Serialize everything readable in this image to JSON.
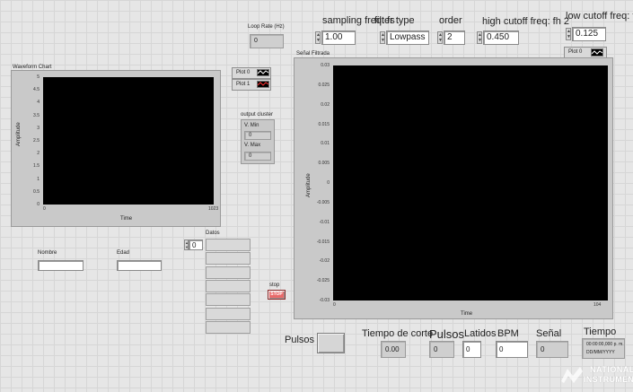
{
  "loop_rate": {
    "label": "Loop Rate (Hz)",
    "value": "0"
  },
  "controls": {
    "sampling": {
      "label": "sampling freq: fs",
      "value": "1.00"
    },
    "filter_type": {
      "label": "filter type",
      "value": "Lowpass"
    },
    "order": {
      "label": "order",
      "value": "2"
    },
    "high_cutoff": {
      "label": "high cutoff freq: fh",
      "value": "0.450",
      "suffix": "2"
    },
    "low_cutoff": {
      "label": "low cutoff freq: fl",
      "value": "0.125"
    }
  },
  "waveform_chart": {
    "label": "Waveform Chart",
    "y_title": "Amplitude",
    "x_title": "Time",
    "y_ticks": [
      "5",
      "4.5",
      "4",
      "3.5",
      "3",
      "2.5",
      "2",
      "1.5",
      "1",
      "0.5",
      "0"
    ],
    "x_start": "0",
    "x_end": "1023"
  },
  "plot_legend": [
    {
      "label": "Plot 0",
      "icon": "waveform-white-icon"
    },
    {
      "label": "Plot 1",
      "icon": "waveform-red-icon"
    }
  ],
  "output_cluster": {
    "label": "output cluster",
    "vmin_label": "V. Min",
    "vmin_value": "0",
    "vmax_label": "V. Max",
    "vmax_value": "0"
  },
  "senal_filtrada": {
    "label": "Señal Filtrada",
    "y_title": "Amplitude",
    "x_title": "Time",
    "y_ticks": [
      "0.03",
      "0.025",
      "0.02",
      "0.015",
      "0.01",
      "0.005",
      "0",
      "-0.005",
      "-0.01",
      "-0.015",
      "-0.02",
      "-0.025",
      "-0.03"
    ],
    "x_start": "0",
    "x_end": "104",
    "legend": "Plot 0"
  },
  "nombre": {
    "label": "Nombre",
    "value": ""
  },
  "edad": {
    "label": "Edad",
    "value": ""
  },
  "datos": {
    "label": "Datos",
    "index": "0"
  },
  "stop": {
    "label": "stop",
    "button": "STOP"
  },
  "pulsos_button": {
    "label": "Pulsos"
  },
  "tiempo_corte": {
    "label": "Tiempo de corte",
    "value": "0.00"
  },
  "pulsos": {
    "label": "Pulsos",
    "value": "0"
  },
  "latidos": {
    "label": "Latidos",
    "value": "0"
  },
  "bpm": {
    "label": "BPM",
    "value": "0"
  },
  "senal": {
    "label": "Señal",
    "value": "0"
  },
  "tiempo": {
    "label": "Tiempo",
    "line1": "00:00:00,000 p. m.",
    "line2": "DD/MM/YYYY"
  },
  "logo": {
    "line1": "NATIONAL",
    "line2": "INSTRUMENTS"
  }
}
